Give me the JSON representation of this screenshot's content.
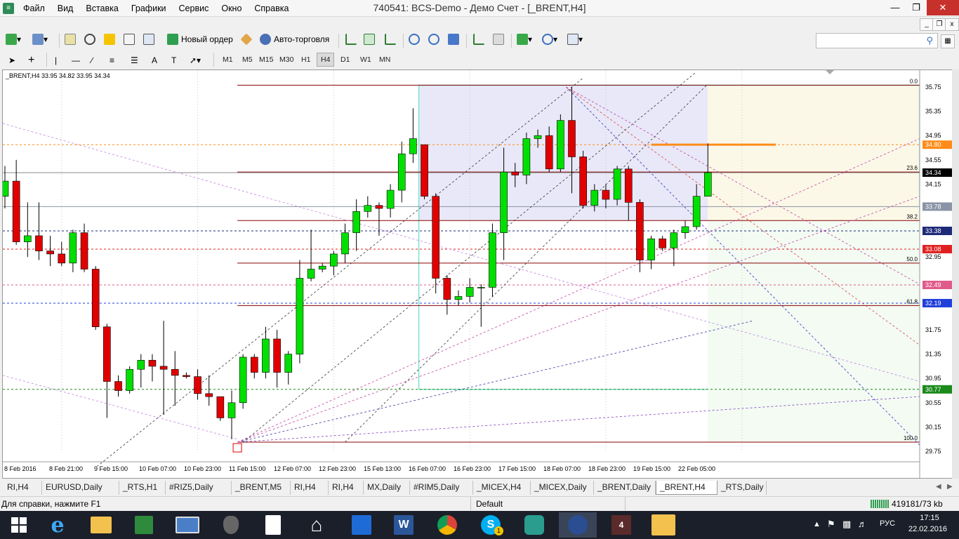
{
  "window": {
    "title": "740541: BCS-Demo - Демо Счет - [_BRENT,H4]"
  },
  "menu": [
    "Файл",
    "Вид",
    "Вставка",
    "Графики",
    "Сервис",
    "Окно",
    "Справка"
  ],
  "toolbar": {
    "new_order": "Новый ордер",
    "auto_trading": "Авто-торговля",
    "timeframes": [
      "M1",
      "M5",
      "M15",
      "M30",
      "H1",
      "H4",
      "D1",
      "W1",
      "MN"
    ],
    "active_timeframe": "H4"
  },
  "chart": {
    "header": "_BRENT,H4  33.95 34.82 33.95 34.34",
    "price_labels": [
      {
        "text": "35.75",
        "price": 35.75
      },
      {
        "text": "35.35",
        "price": 35.35
      },
      {
        "text": "34.95",
        "price": 34.95
      },
      {
        "text": "34.55",
        "price": 34.55
      },
      {
        "text": "34.15",
        "price": 34.15
      },
      {
        "text": "32.95",
        "price": 32.95
      },
      {
        "text": "31.75",
        "price": 31.75
      },
      {
        "text": "31.35",
        "price": 31.35
      },
      {
        "text": "30.95",
        "price": 30.95
      },
      {
        "text": "30.55",
        "price": 30.55
      },
      {
        "text": "30.15",
        "price": 30.15
      },
      {
        "text": "29.75",
        "price": 29.75
      }
    ],
    "marked_prices": [
      {
        "text": "34.80",
        "price": 34.8,
        "bg": "#ff8c1a",
        "fg": "#ffffff"
      },
      {
        "text": "34.34",
        "price": 34.34,
        "bg": "#000000",
        "fg": "#ffffff"
      },
      {
        "text": "33.78",
        "price": 33.78,
        "bg": "#8a94a6",
        "fg": "#ffffff"
      },
      {
        "text": "33.38",
        "price": 33.38,
        "bg": "#1e2a78",
        "fg": "#ffffff"
      },
      {
        "text": "33.08",
        "price": 33.08,
        "bg": "#e02020",
        "fg": "#ffffff"
      },
      {
        "text": "32.49",
        "price": 32.49,
        "bg": "#e05a8a",
        "fg": "#ffffff"
      },
      {
        "text": "32.19",
        "price": 32.19,
        "bg": "#1f3fd8",
        "fg": "#ffffff"
      },
      {
        "text": "30.77",
        "price": 30.77,
        "bg": "#1a8a1a",
        "fg": "#ffffff"
      }
    ],
    "fib_levels": [
      {
        "label": "0.0",
        "price": 35.78
      },
      {
        "label": "23.6",
        "price": 34.35
      },
      {
        "label": "38.2",
        "price": 33.55
      },
      {
        "label": "50.0",
        "price": 32.85
      },
      {
        "label": "61.8",
        "price": 32.15
      },
      {
        "label": "100.0",
        "price": 29.9
      }
    ],
    "time_labels": [
      "8 Feb 2016",
      "8 Feb 21:00",
      "9 Feb 15:00",
      "10 Feb 07:00",
      "10 Feb 23:00",
      "11 Feb 15:00",
      "12 Feb 07:00",
      "12 Feb 23:00",
      "15 Feb 13:00",
      "16 Feb 07:00",
      "16 Feb 23:00",
      "17 Feb 15:00",
      "18 Feb 07:00",
      "18 Feb 23:00",
      "19 Feb 15:00",
      "22 Feb 05:00"
    ],
    "colors": {
      "bull": "#00e000",
      "bear": "#e00000",
      "fib": "#8b0000",
      "grid": "#c8c8c8"
    }
  },
  "chart_data": {
    "type": "candlestick",
    "title": "_BRENT,H4",
    "ylim": [
      29.75,
      35.75
    ],
    "candles": [
      {
        "o": 33.95,
        "h": 34.45,
        "l": 33.75,
        "c": 34.2
      },
      {
        "o": 34.2,
        "h": 34.55,
        "l": 33.15,
        "c": 33.2
      },
      {
        "o": 33.2,
        "h": 33.85,
        "l": 32.95,
        "c": 33.3
      },
      {
        "o": 33.3,
        "h": 33.85,
        "l": 32.9,
        "c": 33.05
      },
      {
        "o": 33.05,
        "h": 33.3,
        "l": 32.8,
        "c": 33.0
      },
      {
        "o": 33.0,
        "h": 33.2,
        "l": 32.8,
        "c": 32.85
      },
      {
        "o": 32.85,
        "h": 33.4,
        "l": 32.7,
        "c": 33.35
      },
      {
        "o": 33.35,
        "h": 33.5,
        "l": 32.7,
        "c": 32.75
      },
      {
        "o": 32.75,
        "h": 32.8,
        "l": 31.75,
        "c": 31.8
      },
      {
        "o": 31.8,
        "h": 31.85,
        "l": 30.3,
        "c": 30.9
      },
      {
        "o": 30.9,
        "h": 31.0,
        "l": 30.65,
        "c": 30.75
      },
      {
        "o": 30.75,
        "h": 31.15,
        "l": 30.7,
        "c": 31.1
      },
      {
        "o": 31.1,
        "h": 31.35,
        "l": 30.8,
        "c": 31.25
      },
      {
        "o": 31.25,
        "h": 31.35,
        "l": 30.9,
        "c": 31.15
      },
      {
        "o": 31.15,
        "h": 31.9,
        "l": 30.35,
        "c": 31.1
      },
      {
        "o": 31.1,
        "h": 31.4,
        "l": 30.5,
        "c": 31.0
      },
      {
        "o": 31.0,
        "h": 31.05,
        "l": 30.95,
        "c": 30.98
      },
      {
        "o": 30.98,
        "h": 31.1,
        "l": 30.6,
        "c": 30.7
      },
      {
        "o": 30.7,
        "h": 31.0,
        "l": 30.5,
        "c": 30.65
      },
      {
        "o": 30.65,
        "h": 30.65,
        "l": 30.25,
        "c": 30.3
      },
      {
        "o": 30.3,
        "h": 30.75,
        "l": 29.95,
        "c": 30.55
      },
      {
        "o": 30.55,
        "h": 31.35,
        "l": 30.45,
        "c": 31.3
      },
      {
        "o": 31.3,
        "h": 31.35,
        "l": 30.95,
        "c": 31.05
      },
      {
        "o": 31.05,
        "h": 31.8,
        "l": 30.95,
        "c": 31.6
      },
      {
        "o": 31.6,
        "h": 31.75,
        "l": 30.8,
        "c": 31.05
      },
      {
        "o": 31.05,
        "h": 31.4,
        "l": 30.85,
        "c": 31.35
      },
      {
        "o": 31.35,
        "h": 32.9,
        "l": 31.2,
        "c": 32.6
      },
      {
        "o": 32.6,
        "h": 33.4,
        "l": 32.55,
        "c": 32.75
      },
      {
        "o": 32.75,
        "h": 32.85,
        "l": 32.7,
        "c": 32.8
      },
      {
        "o": 32.8,
        "h": 33.05,
        "l": 32.65,
        "c": 33.0
      },
      {
        "o": 33.0,
        "h": 33.5,
        "l": 32.85,
        "c": 33.35
      },
      {
        "o": 33.35,
        "h": 33.9,
        "l": 33.05,
        "c": 33.7
      },
      {
        "o": 33.7,
        "h": 33.95,
        "l": 33.6,
        "c": 33.8
      },
      {
        "o": 33.8,
        "h": 33.85,
        "l": 33.3,
        "c": 33.75
      },
      {
        "o": 33.75,
        "h": 34.15,
        "l": 33.6,
        "c": 34.05
      },
      {
        "o": 34.05,
        "h": 34.85,
        "l": 33.85,
        "c": 34.65
      },
      {
        "o": 34.65,
        "h": 35.4,
        "l": 34.5,
        "c": 34.9
      },
      {
        "o": 34.8,
        "h": 34.8,
        "l": 33.9,
        "c": 33.95
      },
      {
        "o": 33.95,
        "h": 34.0,
        "l": 32.35,
        "c": 32.6
      },
      {
        "o": 32.6,
        "h": 32.65,
        "l": 32.0,
        "c": 32.25
      },
      {
        "o": 32.25,
        "h": 32.4,
        "l": 32.15,
        "c": 32.3
      },
      {
        "o": 32.3,
        "h": 32.6,
        "l": 32.2,
        "c": 32.45
      },
      {
        "o": 32.45,
        "h": 32.5,
        "l": 31.8,
        "c": 32.45
      },
      {
        "o": 32.45,
        "h": 33.5,
        "l": 32.3,
        "c": 33.35
      },
      {
        "o": 33.35,
        "h": 34.75,
        "l": 32.9,
        "c": 34.35
      },
      {
        "o": 34.35,
        "h": 34.5,
        "l": 34.1,
        "c": 34.3
      },
      {
        "o": 34.3,
        "h": 35.0,
        "l": 34.15,
        "c": 34.9
      },
      {
        "o": 34.9,
        "h": 35.05,
        "l": 34.75,
        "c": 34.95
      },
      {
        "o": 34.95,
        "h": 35.1,
        "l": 34.35,
        "c": 34.4
      },
      {
        "o": 34.4,
        "h": 35.3,
        "l": 34.35,
        "c": 35.2
      },
      {
        "o": 35.2,
        "h": 35.75,
        "l": 34.0,
        "c": 34.6
      },
      {
        "o": 34.6,
        "h": 34.7,
        "l": 33.75,
        "c": 33.8
      },
      {
        "o": 33.8,
        "h": 34.15,
        "l": 33.7,
        "c": 34.05
      },
      {
        "o": 34.05,
        "h": 34.15,
        "l": 33.75,
        "c": 33.9
      },
      {
        "o": 33.9,
        "h": 34.45,
        "l": 33.8,
        "c": 34.4
      },
      {
        "o": 34.4,
        "h": 34.45,
        "l": 33.55,
        "c": 33.85
      },
      {
        "o": 33.85,
        "h": 33.9,
        "l": 32.7,
        "c": 32.9
      },
      {
        "o": 32.9,
        "h": 33.3,
        "l": 32.75,
        "c": 33.25
      },
      {
        "o": 33.25,
        "h": 33.3,
        "l": 33.05,
        "c": 33.1
      },
      {
        "o": 33.1,
        "h": 33.4,
        "l": 32.8,
        "c": 33.35
      },
      {
        "o": 33.35,
        "h": 33.55,
        "l": 33.25,
        "c": 33.45
      },
      {
        "o": 33.45,
        "h": 34.15,
        "l": 33.4,
        "c": 33.95
      },
      {
        "o": 33.95,
        "h": 34.82,
        "l": 33.95,
        "c": 34.34
      }
    ]
  },
  "tabs": [
    {
      "label": "RI,H4",
      "active": false
    },
    {
      "label": "EURUSD,Daily",
      "active": false
    },
    {
      "label": "_RTS,H1",
      "active": false
    },
    {
      "label": "#RIZ5,Daily",
      "active": false
    },
    {
      "label": "_BRENT,M5",
      "active": false
    },
    {
      "label": "RI,H4",
      "active": false
    },
    {
      "label": "RI,H4",
      "active": false
    },
    {
      "label": "MX,Daily",
      "active": false
    },
    {
      "label": "#RIM5,Daily",
      "active": false
    },
    {
      "label": "_MICEX,H4",
      "active": false
    },
    {
      "label": "_MICEX,Daily",
      "active": false
    },
    {
      "label": "_BRENT,Daily",
      "active": false
    },
    {
      "label": "_BRENT,H4",
      "active": true
    },
    {
      "label": "_RTS,Daily",
      "active": false
    }
  ],
  "status": {
    "help": "Для справки, нажмите F1",
    "profile": "Default",
    "traffic": "419181/73 kb"
  },
  "taskbar": {
    "lang": "РУС",
    "time": "17:15",
    "date": "22.02.2016",
    "pinned_badge": "4",
    "skype_badge": "1"
  }
}
